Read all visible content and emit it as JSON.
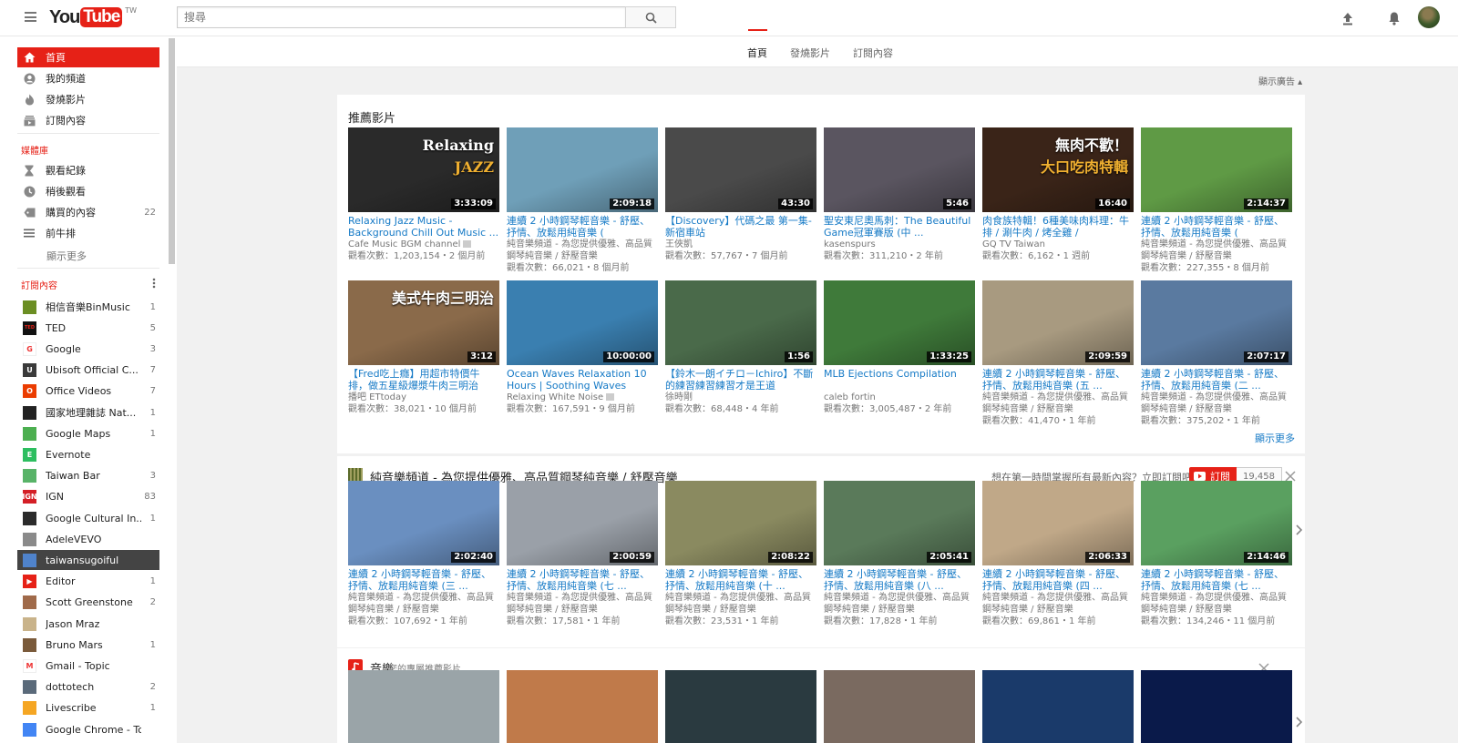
{
  "header": {
    "logo_you": "You",
    "logo_tube": "Tube",
    "logo_region": "TW",
    "search_placeholder": "搜尋"
  },
  "sidebar": {
    "main": [
      {
        "label": "首頁",
        "icon": "home-icon"
      },
      {
        "label": "我的頻道",
        "icon": "person-icon"
      },
      {
        "label": "發燒影片",
        "icon": "flame-icon"
      },
      {
        "label": "訂閱內容",
        "icon": "subscriptions-icon"
      }
    ],
    "library_heading": "媒體庫",
    "library": [
      {
        "label": "觀看紀錄",
        "icon": "hourglass-icon",
        "count": ""
      },
      {
        "label": "稍後觀看",
        "icon": "clock-icon",
        "count": ""
      },
      {
        "label": "購買的內容",
        "icon": "tag-icon",
        "count": "22"
      },
      {
        "label": "前牛排",
        "icon": "list-icon",
        "count": ""
      }
    ],
    "show_more": "顯示更多",
    "subs_heading": "訂閱內容",
    "subscriptions": [
      {
        "label": "相信音樂BinMusic",
        "count": "1",
        "color": "#6b8e23"
      },
      {
        "label": "TED",
        "count": "5",
        "color": "#111111"
      },
      {
        "label": "Google",
        "count": "3",
        "color": "#ffffff"
      },
      {
        "label": "Ubisoft Official C...",
        "count": "7",
        "color": "#3a3a3a"
      },
      {
        "label": "Office Videos",
        "count": "7",
        "color": "#eb3c00"
      },
      {
        "label": "國家地理雜誌 Nat...",
        "count": "1",
        "color": "#222222"
      },
      {
        "label": "Google Maps",
        "count": "1",
        "color": "#4caf50"
      },
      {
        "label": "Evernote",
        "count": "",
        "color": "#2dbe60"
      },
      {
        "label": "Taiwan Bar",
        "count": "3",
        "color": "#58b368"
      },
      {
        "label": "IGN",
        "count": "83",
        "color": "#d41f26"
      },
      {
        "label": "Google Cultural In...",
        "count": "1",
        "color": "#2b2b2b"
      },
      {
        "label": "AdeleVEVO",
        "count": "",
        "color": "#8a8a8a"
      },
      {
        "label": "taiwansugoiful",
        "count": "",
        "color": "#4f83cc"
      },
      {
        "label": "Editor",
        "count": "1",
        "color": "#e62117"
      },
      {
        "label": "Scott Greenstone",
        "count": "2",
        "color": "#a06a4a"
      },
      {
        "label": "Jason Mraz",
        "count": "",
        "color": "#c9b38a"
      },
      {
        "label": "Bruno Mars",
        "count": "1",
        "color": "#7a5a3a"
      },
      {
        "label": "Gmail - Topic",
        "count": "",
        "color": "#ffffff"
      },
      {
        "label": "dottotech",
        "count": "2",
        "color": "#5a6a7a"
      },
      {
        "label": "Livescribe",
        "count": "1",
        "color": "#f5a623"
      },
      {
        "label": "Google Chrome - Topic",
        "count": "",
        "color": "#4285f4"
      }
    ]
  },
  "tabs": [
    "首頁",
    "發燒影片",
    "訂閱內容"
  ],
  "ad_toggle": "顯示廣告 ▴",
  "recommended": {
    "title": "推薦影片",
    "show_more": "顯示更多",
    "videos": [
      {
        "title": "Relaxing Jazz Music - Background Chill Out Music ...",
        "channel": "Cafe Music BGM channel",
        "verified": true,
        "desc": "",
        "meta": "觀看次數：1,203,154・2 個月前",
        "duration": "3:33:09",
        "thumb_text": "Relaxing",
        "thumb_text2": "JAZZ",
        "bg": "#2a2a2a"
      },
      {
        "title": "連續 2 小時鋼琴輕音樂 - 舒壓、抒情、放鬆用純音樂 (",
        "channel": "",
        "desc": "純音樂頻道 - 為您提供優雅、高品質鋼琴純音樂 / 舒壓音樂",
        "meta": "觀看次數：66,021・8 個月前",
        "duration": "2:09:18",
        "bg": "#6f9fb8"
      },
      {
        "title": "【Discovery】代碼之最 第一集-新宿車站",
        "channel": "王俠凱",
        "desc": "",
        "meta": "觀看次數：57,767・7 個月前",
        "duration": "43:30",
        "bg": "#4a4a4a"
      },
      {
        "title": "聖安東尼奧馬刺：The Beautiful Game冠軍賽版 (中 ...",
        "channel": "kasenspurs",
        "desc": "",
        "meta": "觀看次數：311,210・2 年前",
        "duration": "5:46",
        "bg": "#5a5560"
      },
      {
        "title": "肉食族特輯！6種美味肉料理：牛排 / 涮牛肉 / 烤全雞 /",
        "channel": "GQ TV Taiwan",
        "desc": "",
        "meta": "觀看次數：6,162・1 週前",
        "duration": "16:40",
        "thumb_text": "無肉不歡！",
        "thumb_text2": "大口吃肉特輯",
        "bg": "#3a2418"
      },
      {
        "title": "連續 2 小時鋼琴輕音樂 - 舒壓、抒情、放鬆用純音樂 (",
        "channel": "",
        "desc": "純音樂頻道 - 為您提供優雅、高品質鋼琴純音樂 / 舒壓音樂",
        "meta": "觀看次數：227,355・8 個月前",
        "duration": "2:14:37",
        "bg": "#5f9a45"
      },
      {
        "title": "【Fred吃上癮】用超市特價牛排，做五星級爆漿牛肉三明治",
        "channel": "播吧 ETtoday",
        "desc": "",
        "meta": "觀看次數：38,021・10 個月前",
        "duration": "3:12",
        "thumb_text": "美式牛肉三明治",
        "bg": "#8a6a4a"
      },
      {
        "title": "Ocean Waves Relaxation 10 Hours | Soothing Waves",
        "channel": "Relaxing White Noise",
        "verified": true,
        "desc": "",
        "meta": "觀看次數：167,591・9 個月前",
        "duration": "10:00:00",
        "bg": "#3a7fb0"
      },
      {
        "title": "【鈴木一朗イチロ－Ichiro】不斷的練習練習練習才是王道",
        "channel": "徐時剛",
        "desc": "",
        "meta": "觀看次數：68,448・4 年前",
        "duration": "1:56",
        "bg": "#4a6a4a"
      },
      {
        "title": "MLB Ejections Compilation",
        "channel": "caleb fortin",
        "desc": "",
        "meta": "觀看次數：3,005,487・2 年前",
        "duration": "1:33:25",
        "bg": "#3f7a3a"
      },
      {
        "title": "連續 2 小時鋼琴輕音樂 - 舒壓、抒情、放鬆用純音樂 (五 ...",
        "channel": "",
        "desc": "純音樂頻道 - 為您提供優雅、高品質鋼琴純音樂 / 舒壓音樂",
        "meta": "觀看次數：41,470・1 年前",
        "duration": "2:09:59",
        "bg": "#a89a80"
      },
      {
        "title": "連續 2 小時鋼琴輕音樂 - 舒壓、抒情、放鬆用純音樂 (二 ...",
        "channel": "",
        "desc": "純音樂頻道 - 為您提供優雅、高品質鋼琴純音樂 / 舒壓音樂",
        "meta": "觀看次數：375,202・1 年前",
        "duration": "2:07:17",
        "bg": "#5a7aa0"
      }
    ]
  },
  "channel_shelf": {
    "title": "純音樂頻道 - 為您提供優雅、高品質鋼琴純音樂 / 舒壓音樂",
    "promo": "想在第一時間掌握所有最新內容？立即訂閱吧！",
    "subscribe_label": "訂閱",
    "subscriber_count": "19,458",
    "videos": [
      {
        "title": "連續 2 小時鋼琴輕音樂 - 舒壓、抒情、放鬆用純音樂 (三 ...",
        "desc": "純音樂頻道 - 為您提供優雅、高品質鋼琴純音樂 / 舒壓音樂",
        "meta": "觀看次數：107,692・1 年前",
        "duration": "2:02:40",
        "bg": "#6a8fc0"
      },
      {
        "title": "連續 2 小時鋼琴輕音樂 - 舒壓、抒情、放鬆用純音樂 (七 ...",
        "desc": "純音樂頻道 - 為您提供優雅、高品質鋼琴純音樂 / 舒壓音樂",
        "meta": "觀看次數：17,581・1 年前",
        "duration": "2:00:59",
        "bg": "#9aa0a8"
      },
      {
        "title": "連續 2 小時鋼琴輕音樂 - 舒壓、抒情、放鬆用純音樂 (十 ...",
        "desc": "純音樂頻道 - 為您提供優雅、高品質鋼琴純音樂 / 舒壓音樂",
        "meta": "觀看次數：23,531・1 年前",
        "duration": "2:08:22",
        "bg": "#8a8a60"
      },
      {
        "title": "連續 2 小時鋼琴輕音樂 - 舒壓、抒情、放鬆用純音樂 (八 ...",
        "desc": "純音樂頻道 - 為您提供優雅、高品質鋼琴純音樂 / 舒壓音樂",
        "meta": "觀看次數：17,828・1 年前",
        "duration": "2:05:41",
        "bg": "#5a7a5a"
      },
      {
        "title": "連續 2 小時鋼琴輕音樂 - 舒壓、抒情、放鬆用純音樂 (四 ...",
        "desc": "純音樂頻道 - 為您提供優雅、高品質鋼琴純音樂 / 舒壓音樂",
        "meta": "觀看次數：69,861・1 年前",
        "duration": "2:06:33",
        "bg": "#c0a888"
      },
      {
        "title": "連續 2 小時鋼琴輕音樂 - 舒壓、抒情、放鬆用純音樂 (七 ...",
        "desc": "純音樂頻道 - 為您提供優雅、高品質鋼琴純音樂 / 舒壓音樂",
        "meta": "觀看次數：134,246・11 個月前",
        "duration": "2:14:46",
        "bg": "#5aa060"
      }
    ]
  },
  "music_shelf": {
    "title": "音樂",
    "subtitle": "您的專屬推薦影片",
    "videos": [
      {
        "bg": "#9aa4a8"
      },
      {
        "bg": "#c07a4a"
      },
      {
        "bg": "#2a3a40"
      },
      {
        "bg": "#7a6a60"
      },
      {
        "bg": "#1a3a6a"
      },
      {
        "bg": "#0a1a4a"
      },
      {
        "bg": "#e8d0c0"
      }
    ]
  }
}
